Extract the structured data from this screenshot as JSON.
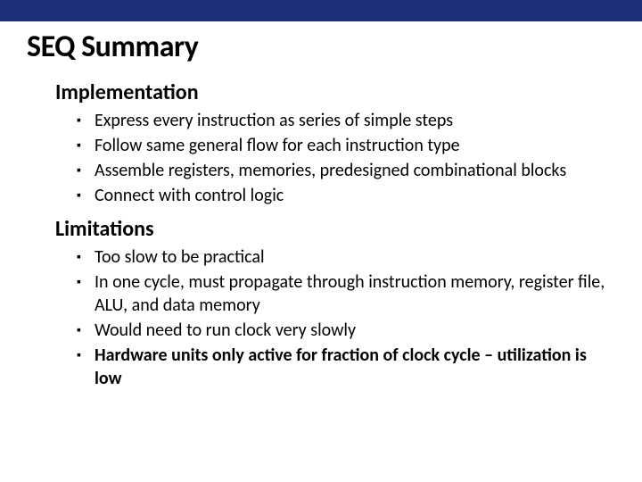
{
  "title": "SEQ Summary",
  "sections": [
    {
      "heading": "Implementation",
      "items": [
        {
          "text": "Express every instruction as series of simple steps",
          "bold": false
        },
        {
          "text": "Follow same general flow for each instruction type",
          "bold": false
        },
        {
          "text": "Assemble registers, memories, predesigned combinational blocks",
          "bold": false
        },
        {
          "text": "Connect with control logic",
          "bold": false
        }
      ]
    },
    {
      "heading": "Limitations",
      "items": [
        {
          "text": "Too slow to be practical",
          "bold": false
        },
        {
          "text": "In one cycle, must propagate through instruction memory, register file, ALU, and data memory",
          "bold": false
        },
        {
          "text": "Would need to run clock very slowly",
          "bold": false
        },
        {
          "text": "Hardware units only active for fraction of clock cycle – utilization is low",
          "bold": true
        }
      ]
    }
  ]
}
